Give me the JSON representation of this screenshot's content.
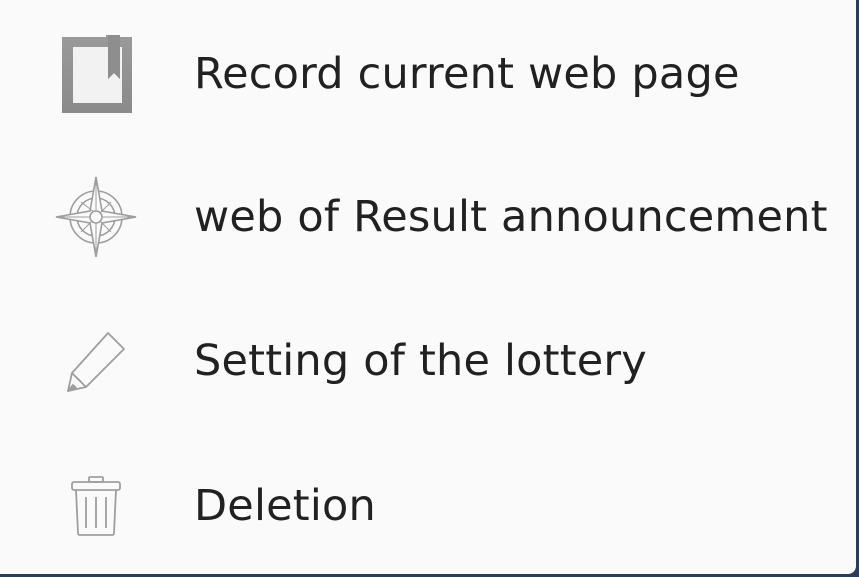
{
  "menu": {
    "items": [
      {
        "label": "Record current web page",
        "icon": "bookmark-icon"
      },
      {
        "label": "web of Result announcement",
        "icon": "compass-icon"
      },
      {
        "label": "Setting of the lottery",
        "icon": "pencil-icon"
      },
      {
        "label": "Deletion",
        "icon": "trash-icon"
      }
    ]
  },
  "colors": {
    "panel_background": "#fafafa",
    "text": "#212121",
    "icon_gray": "#9e9e9e",
    "backdrop": "#2c3e57"
  }
}
